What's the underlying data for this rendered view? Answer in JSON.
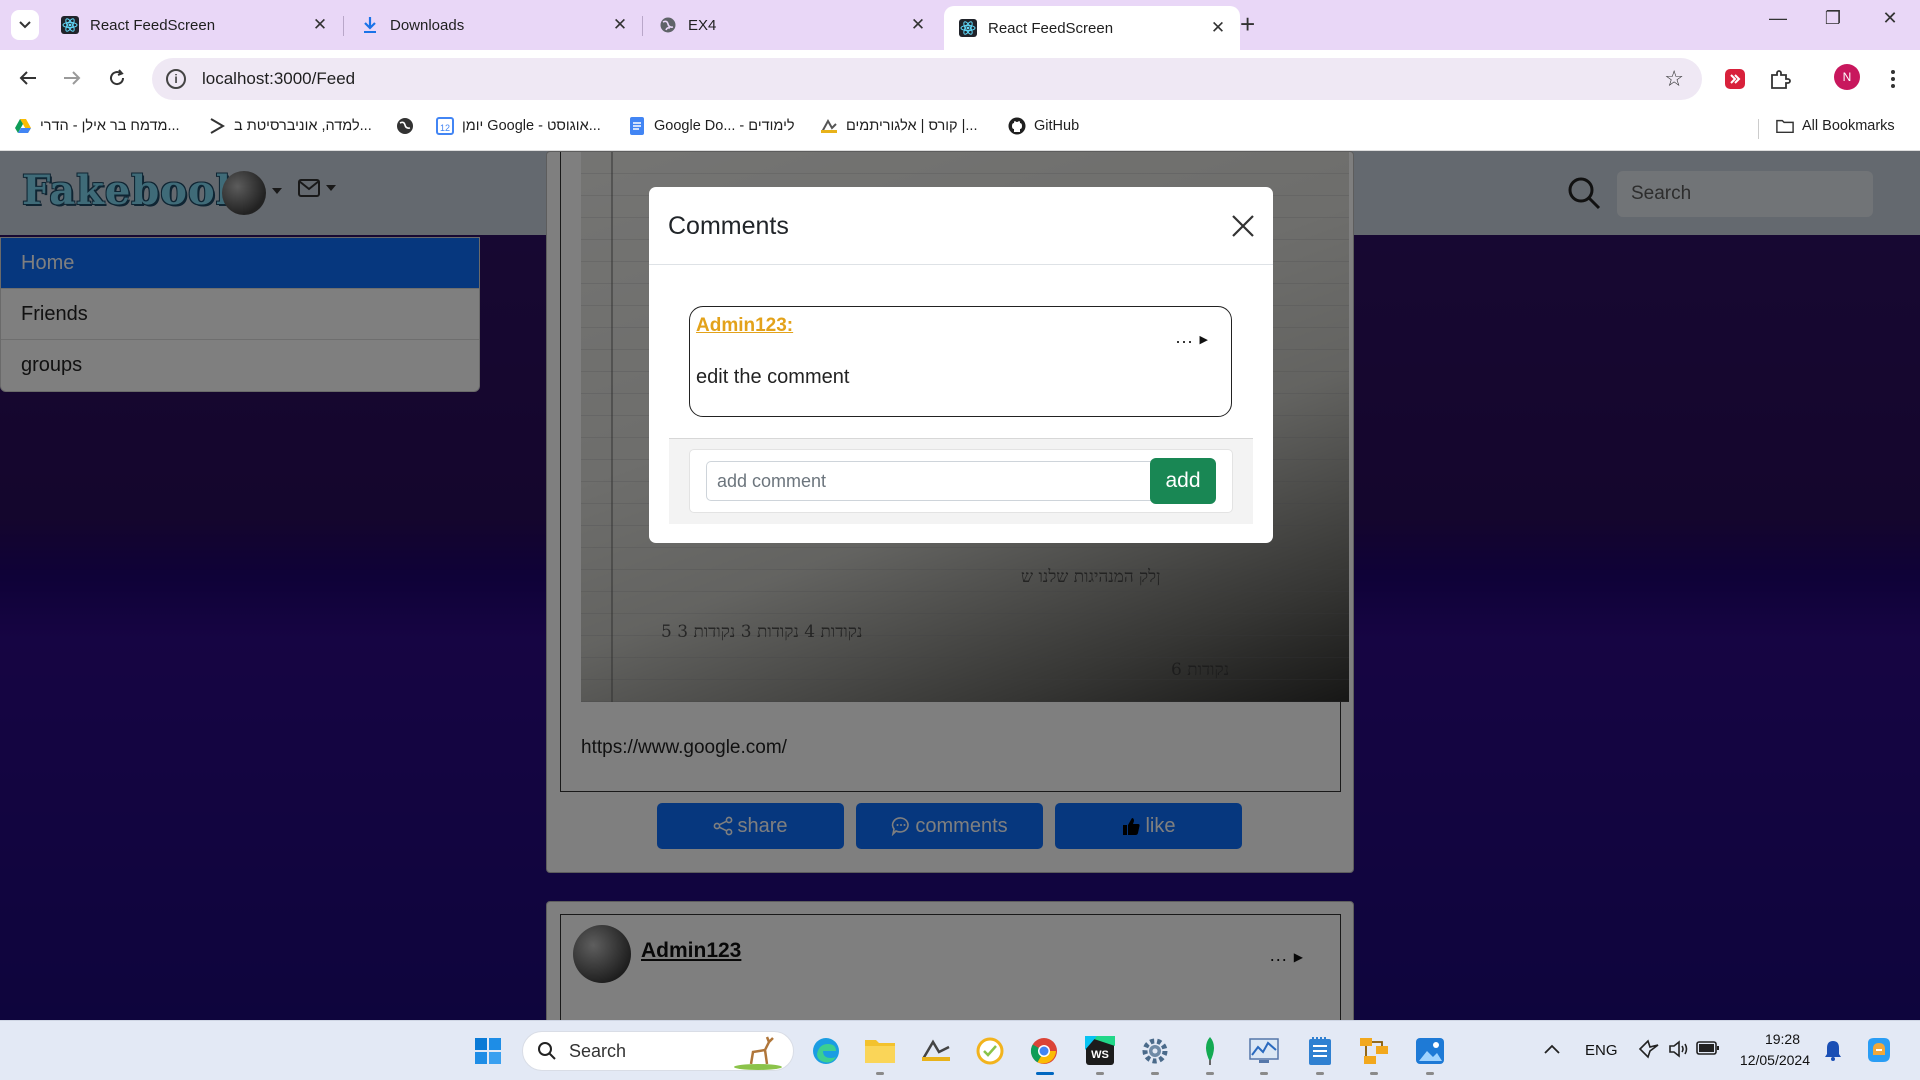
{
  "browser": {
    "tabs": [
      {
        "title": "React FeedScreen",
        "icon": "react-icon",
        "active": false
      },
      {
        "title": "Downloads",
        "icon": "download-icon",
        "active": false
      },
      {
        "title": "EX4",
        "icon": "globe-icon",
        "active": false
      },
      {
        "title": "React FeedScreen",
        "icon": "react-icon",
        "active": true
      }
    ],
    "url": "localhost:3000/Feed",
    "profile_initial": "N",
    "bookmarks": [
      {
        "label": "מדמח בר אילן - הדרי...",
        "icon": "drive-icon"
      },
      {
        "label": "למדה, אוניברסיטת ב...",
        "icon": "moodle-icon"
      },
      {
        "label": "",
        "icon": "globe-icon"
      },
      {
        "label": "יומן Google - אוגוסט...",
        "icon": "calendar-icon"
      },
      {
        "label": "Google Do... - לימודים",
        "icon": "docs-icon"
      },
      {
        "label": "קורס | אלגוריתמים |...",
        "icon": "course-icon"
      },
      {
        "label": "GitHub",
        "icon": "github-icon"
      }
    ],
    "all_bookmarks_label": "All Bookmarks"
  },
  "site": {
    "logo": "Fakebook",
    "search_placeholder": "Search",
    "sidebar": [
      {
        "label": "Home",
        "active": true
      },
      {
        "label": "Friends",
        "active": false
      },
      {
        "label": "groups",
        "active": false
      }
    ]
  },
  "post": {
    "photo_text": [
      "ןלק המנהיגות שלנו ש",
      "5 נקודות  4  נקודות  3  נקודות  3  ",
      "6 נקודות"
    ],
    "link": "https://www.google.com/",
    "actions": {
      "share": "share",
      "comments": "comments",
      "like": "like"
    }
  },
  "post2": {
    "author": "Admin123",
    "menu": "..."
  },
  "modal": {
    "title": "Comments",
    "comments": [
      {
        "author": "Admin123:",
        "text": "edit the comment",
        "menu": "..."
      }
    ],
    "input_placeholder": "add comment",
    "add_label": "add"
  },
  "taskbar": {
    "search_label": "Search",
    "lang": "ENG",
    "time": "19:28",
    "date": "12/05/2024"
  },
  "colors": {
    "primary": "#0d6efd",
    "success": "#198754",
    "author": "#e3a21a",
    "tabbar": "#e9d7f7"
  }
}
